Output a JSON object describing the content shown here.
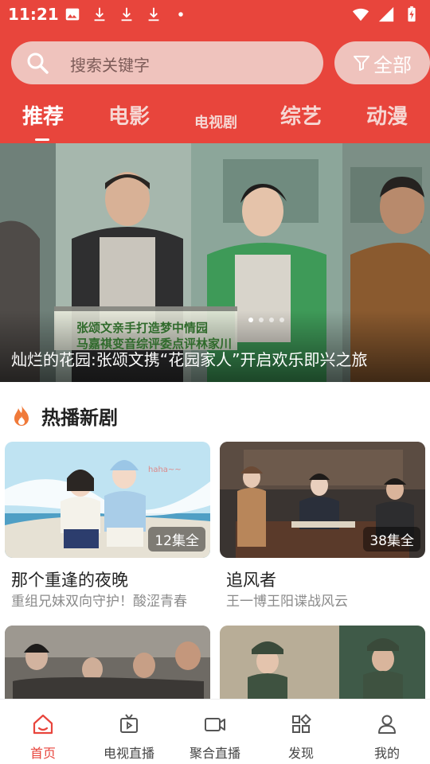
{
  "status_bar": {
    "time": "11:21"
  },
  "search": {
    "placeholder": "搜索关键字",
    "filter_label": "全部"
  },
  "tabs": [
    {
      "label": "推荐",
      "active": true
    },
    {
      "label": "电影",
      "active": false
    },
    {
      "label": "电视剧",
      "active": false
    },
    {
      "label": "综艺",
      "active": false
    },
    {
      "label": "动漫",
      "active": false
    }
  ],
  "banner": {
    "caption": "灿烂的花园:张颂文携“花园家人”开启欢乐即兴之旅",
    "subtitle_line1": "张颂文亲手打造梦中情园",
    "subtitle_line2": "马嘉祺变音综评委点评林家川"
  },
  "section": {
    "title": "热播新剧",
    "icon": "fire-icon"
  },
  "cards": [
    {
      "title": "那个重逢的夜晚",
      "subtitle": "重组兄妹双向守护！酸涩青春",
      "badge": "12集全"
    },
    {
      "title": "追风者",
      "subtitle": "王一博王阳谍战风云",
      "badge": "38集全"
    }
  ],
  "bottom_nav": [
    {
      "label": "首页",
      "icon": "home-icon",
      "active": true
    },
    {
      "label": "电视直播",
      "icon": "tv-icon",
      "active": false
    },
    {
      "label": "聚合直播",
      "icon": "video-camera-icon",
      "active": false
    },
    {
      "label": "发现",
      "icon": "discover-icon",
      "active": false
    },
    {
      "label": "我的",
      "icon": "user-icon",
      "active": false
    }
  ],
  "colors": {
    "brand": "#e8453c",
    "search_bg": "#efc3bd",
    "active_nav": "#e8453c"
  }
}
